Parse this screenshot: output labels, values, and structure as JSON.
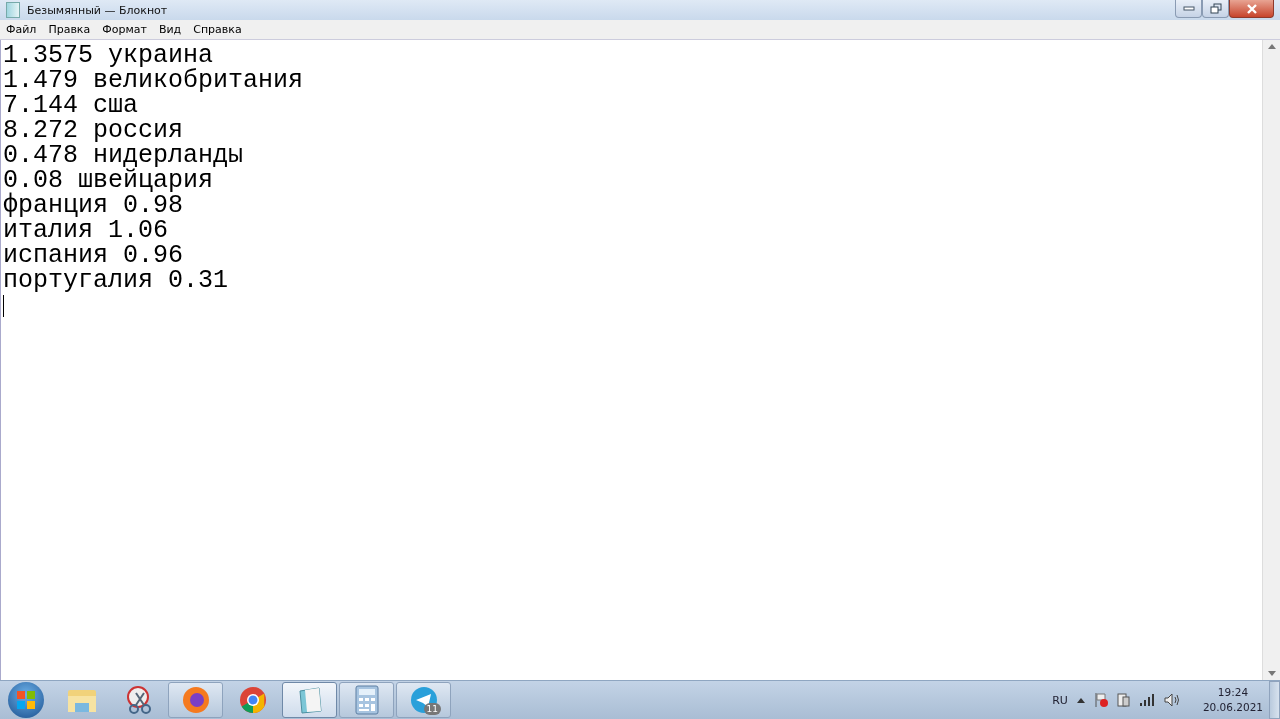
{
  "window": {
    "title": "Безымянный — Блокнот"
  },
  "menu": [
    "Файл",
    "Правка",
    "Формат",
    "Вид",
    "Справка"
  ],
  "editor": {
    "lines": [
      "1.3575 украина",
      "1.479 великобритания",
      "7.144 сша",
      "8.272 россия",
      "0.478 нидерланды",
      "0.08 швейцария",
      "франция 0.98",
      "италия 1.06",
      "испания 0.96",
      "португалия 0.31"
    ]
  },
  "taskbar": {
    "apps": [
      {
        "kind": "folder",
        "open": false,
        "selected": false
      },
      {
        "kind": "scissors",
        "open": false,
        "selected": false
      },
      {
        "kind": "firefox",
        "open": true,
        "selected": false
      },
      {
        "kind": "chrome",
        "open": false,
        "selected": false
      },
      {
        "kind": "notepad",
        "open": true,
        "selected": true
      },
      {
        "kind": "calculator",
        "open": true,
        "selected": false
      },
      {
        "kind": "telegram",
        "open": true,
        "selected": false,
        "badge": "11"
      }
    ],
    "language": "RU",
    "time": "19:24",
    "date": "20.06.2021"
  }
}
